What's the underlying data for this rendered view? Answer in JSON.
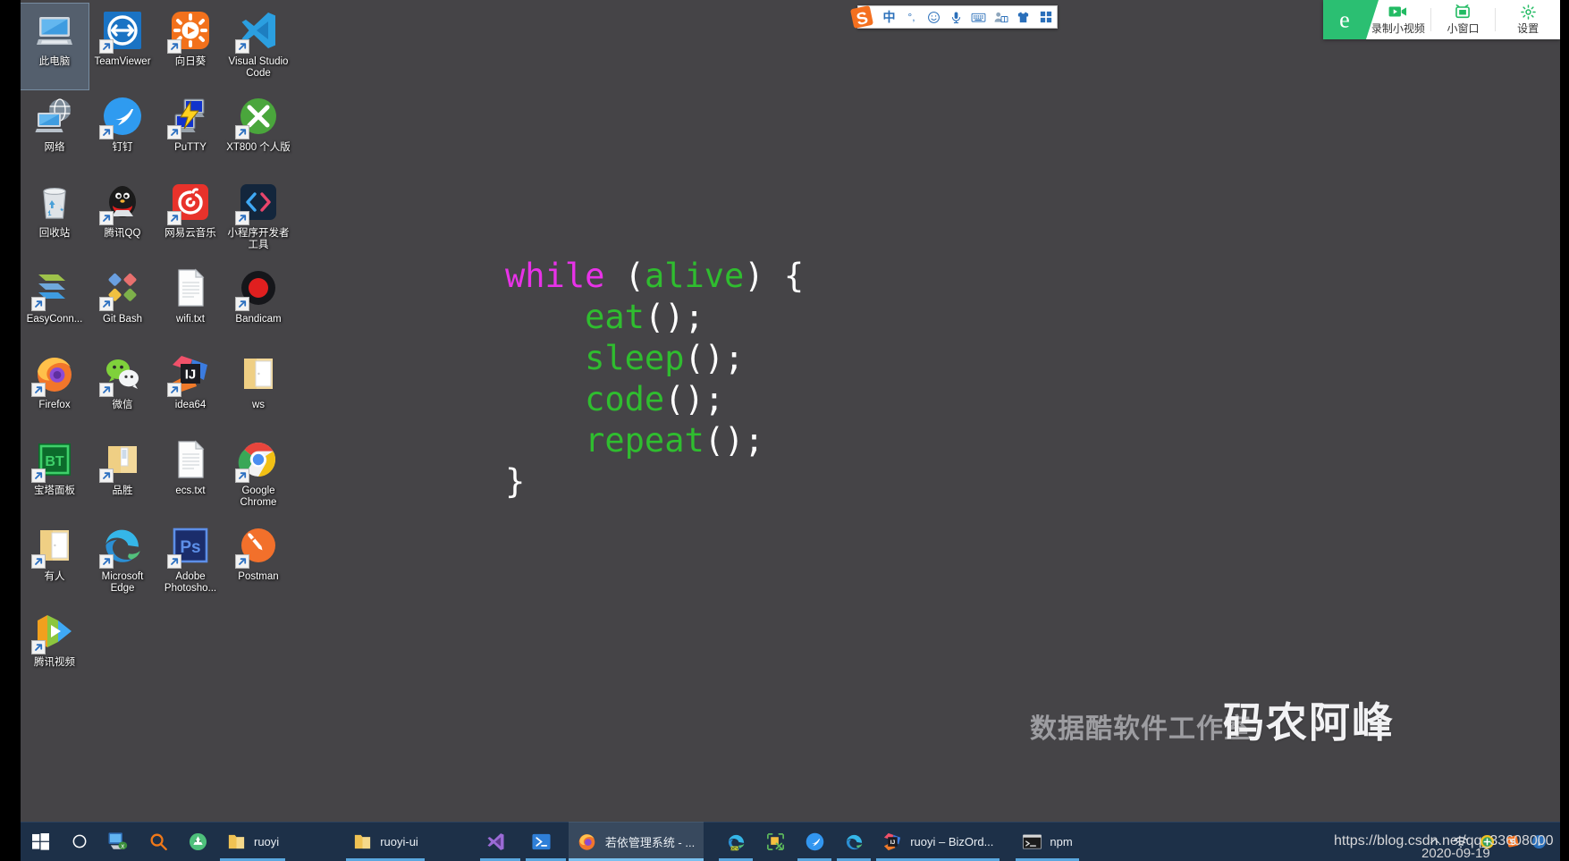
{
  "desktop": {
    "background_color": "#454447",
    "icons": [
      {
        "label": "此电脑",
        "icon": "this-pc",
        "selected": true,
        "shortcut": false
      },
      {
        "label": "TeamViewer",
        "icon": "teamviewer",
        "selected": false,
        "shortcut": true
      },
      {
        "label": "向日葵",
        "icon": "sunflower-remote",
        "selected": false,
        "shortcut": true
      },
      {
        "label": "Visual Studio Code",
        "icon": "vscode",
        "selected": false,
        "shortcut": true
      },
      {
        "label": "网络",
        "icon": "network",
        "selected": false,
        "shortcut": false
      },
      {
        "label": "钉钉",
        "icon": "dingtalk",
        "selected": false,
        "shortcut": true
      },
      {
        "label": "PuTTY",
        "icon": "putty",
        "selected": false,
        "shortcut": true
      },
      {
        "label": "XT800 个人版",
        "icon": "xt800",
        "selected": false,
        "shortcut": true
      },
      {
        "label": "回收站",
        "icon": "recycle-bin",
        "selected": false,
        "shortcut": false
      },
      {
        "label": "腾讯QQ",
        "icon": "tencent-qq",
        "selected": false,
        "shortcut": true
      },
      {
        "label": "网易云音乐",
        "icon": "netease-music",
        "selected": false,
        "shortcut": true
      },
      {
        "label": "小程序开发者工具",
        "icon": "wechat-devtools",
        "selected": false,
        "shortcut": true
      },
      {
        "label": "EasyConn...",
        "icon": "easyconnect",
        "selected": false,
        "shortcut": true
      },
      {
        "label": "Git Bash",
        "icon": "git-bash",
        "selected": false,
        "shortcut": true
      },
      {
        "label": "wifi.txt",
        "icon": "text-file",
        "selected": false,
        "shortcut": false
      },
      {
        "label": "Bandicam",
        "icon": "bandicam",
        "selected": false,
        "shortcut": true
      },
      {
        "label": "Firefox",
        "icon": "firefox",
        "selected": false,
        "shortcut": true
      },
      {
        "label": "微信",
        "icon": "wechat",
        "selected": false,
        "shortcut": true
      },
      {
        "label": "idea64",
        "icon": "intellij-idea",
        "selected": false,
        "shortcut": true
      },
      {
        "label": "ws",
        "icon": "folder-open",
        "selected": false,
        "shortcut": false
      },
      {
        "label": "宝塔面板",
        "icon": "baota-panel",
        "selected": false,
        "shortcut": true
      },
      {
        "label": "品胜",
        "icon": "folder-docs",
        "selected": false,
        "shortcut": true
      },
      {
        "label": "ecs.txt",
        "icon": "text-file",
        "selected": false,
        "shortcut": false
      },
      {
        "label": "Google Chrome",
        "icon": "chrome",
        "selected": false,
        "shortcut": true
      },
      {
        "label": "有人",
        "icon": "folder-open",
        "selected": false,
        "shortcut": true
      },
      {
        "label": "Microsoft Edge",
        "icon": "edge",
        "selected": false,
        "shortcut": true
      },
      {
        "label": "Adobe Photosho...",
        "icon": "photoshop",
        "selected": false,
        "shortcut": true
      },
      {
        "label": "Postman",
        "icon": "postman",
        "selected": false,
        "shortcut": true
      },
      {
        "label": "腾讯视频",
        "icon": "tencent-video",
        "selected": false,
        "shortcut": true
      }
    ]
  },
  "wallpaper_code": {
    "lines": [
      [
        {
          "t": "while",
          "c": "kw"
        },
        {
          "t": " ",
          "c": "pn"
        },
        {
          "t": "(",
          "c": "pn"
        },
        {
          "t": "alive",
          "c": "fn"
        },
        {
          "t": ") {",
          "c": "pn"
        }
      ],
      [
        {
          "t": "    ",
          "c": "pn"
        },
        {
          "t": "eat",
          "c": "fn"
        },
        {
          "t": "();",
          "c": "pn"
        }
      ],
      [
        {
          "t": "    ",
          "c": "pn"
        },
        {
          "t": "sleep",
          "c": "fn"
        },
        {
          "t": "();",
          "c": "pn"
        }
      ],
      [
        {
          "t": "    ",
          "c": "pn"
        },
        {
          "t": "code",
          "c": "fn"
        },
        {
          "t": "();",
          "c": "pn"
        }
      ],
      [
        {
          "t": "    ",
          "c": "pn"
        },
        {
          "t": "repeat",
          "c": "fn"
        },
        {
          "t": "();",
          "c": "pn"
        }
      ],
      [
        {
          "t": "}",
          "c": "pn"
        }
      ]
    ],
    "keyword_color": "#e832e8",
    "function_color": "#2fbd2f",
    "punctuation_color": "#ffffff"
  },
  "ime_bar": {
    "logo": "sogou-logo",
    "items": [
      {
        "glyph": "中",
        "name": "language-mode"
      },
      {
        "glyph": "°,",
        "name": "punctuation-mode"
      },
      {
        "glyph": "☺",
        "name": "emoji-picker"
      },
      {
        "glyph": "mic",
        "name": "voice-input"
      },
      {
        "glyph": "keyboard",
        "name": "soft-keyboard"
      },
      {
        "glyph": "toolbox",
        "name": "toolbox"
      },
      {
        "glyph": "shirt",
        "name": "skin-center"
      },
      {
        "glyph": "grid",
        "name": "more-menu"
      }
    ]
  },
  "recorder_bar": {
    "logo": "e-browser-logo",
    "items": [
      {
        "label": "录制小视频",
        "icon": "video-record-icon"
      },
      {
        "label": "小窗口",
        "icon": "mini-window-icon"
      },
      {
        "label": "设置",
        "icon": "gear-icon"
      }
    ]
  },
  "watermarks": {
    "studio": "数据酷软件工作室",
    "author": "码农阿峰",
    "url": "https://blog.csdn.net/qq_33608000",
    "date": "2020-09-19"
  },
  "taskbar": {
    "background_color": "#1d3048",
    "system_buttons": [
      {
        "name": "start-button",
        "icon": "windows-logo"
      },
      {
        "name": "cortana-button",
        "icon": "circle-icon"
      },
      {
        "name": "task-view-button",
        "icon": "task-view-icon"
      },
      {
        "name": "search-button",
        "icon": "search-icon"
      },
      {
        "name": "android-studio-button",
        "icon": "android-studio-icon"
      }
    ],
    "tasks": [
      {
        "label": "ruoyi",
        "icon": "folder-icon",
        "open": true,
        "active": false
      },
      {
        "label": "ruoyi-ui",
        "icon": "folder-icon",
        "open": true,
        "active": false
      },
      {
        "label": "",
        "icon": "vscode-icon",
        "open": true,
        "active": false
      },
      {
        "label": "",
        "icon": "powershell-icon",
        "open": true,
        "active": false
      },
      {
        "label": "若依管理系统 - ...",
        "icon": "firefox-icon",
        "open": true,
        "active": true
      },
      {
        "label": "",
        "icon": "edge-dev-icon",
        "open": true,
        "active": false
      },
      {
        "label": "",
        "icon": "snip-tool-icon",
        "open": false,
        "active": false
      },
      {
        "label": "",
        "icon": "dingtalk-icon",
        "open": true,
        "active": false
      },
      {
        "label": "",
        "icon": "edge-icon",
        "open": true,
        "active": false
      },
      {
        "label": "ruoyi – BizOrd...",
        "icon": "intellij-icon",
        "open": true,
        "active": false
      },
      {
        "label": "npm",
        "icon": "terminal-icon",
        "open": true,
        "active": false
      }
    ],
    "tray": [
      {
        "name": "show-hidden-icons",
        "icon": "chevron-up-icon"
      },
      {
        "name": "network-icon",
        "icon": "wifi-icon"
      },
      {
        "name": "security-icon",
        "icon": "shield-green-icon"
      },
      {
        "name": "ime-tray-icon",
        "icon": "sogou-tray-icon"
      },
      {
        "name": "info-icon",
        "icon": "info-circle-icon"
      }
    ]
  }
}
